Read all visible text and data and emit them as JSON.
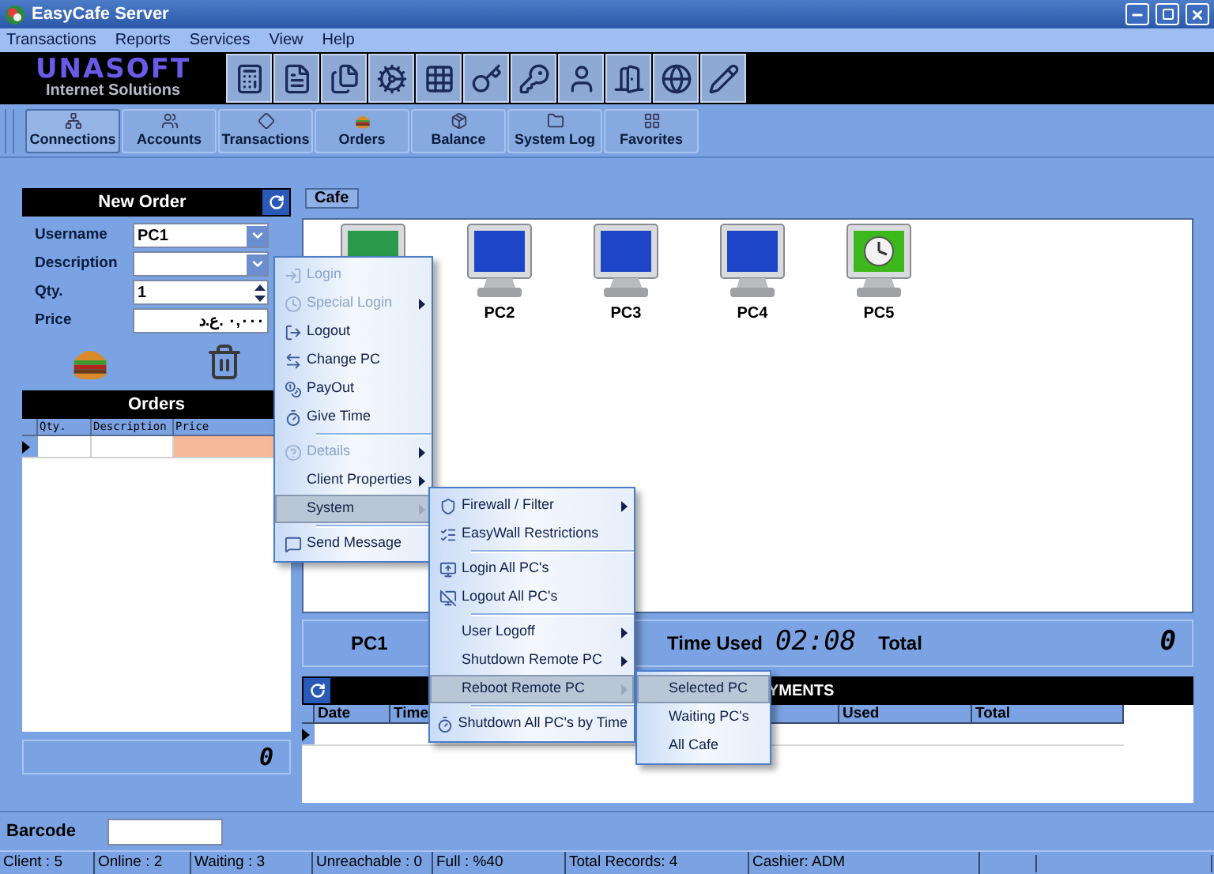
{
  "window": {
    "title": "EasyCafe Server"
  },
  "menu_bar": [
    "Transactions",
    "Reports",
    "Services",
    "View",
    "Help"
  ],
  "logo": {
    "title": "UNASOFT",
    "subtitle": "Internet Solutions"
  },
  "tabs": [
    {
      "label": "Connections",
      "selected": true
    },
    {
      "label": "Accounts",
      "selected": false
    },
    {
      "label": "Transactions",
      "selected": false
    },
    {
      "label": "Orders",
      "selected": false
    },
    {
      "label": "Balance",
      "selected": false
    },
    {
      "label": "System Log",
      "selected": false
    },
    {
      "label": "Favorites",
      "selected": false
    }
  ],
  "new_order": {
    "title": "New Order",
    "fields": [
      {
        "label": "Username",
        "value": "PC1",
        "kind": "dropdown"
      },
      {
        "label": "Description",
        "kind": "dropdown"
      },
      {
        "label": "Qty.",
        "value": "1",
        "kind": "spinner"
      },
      {
        "label": "Price",
        "value": "٠,٠٠٠ .ع.د",
        "kind": "text"
      }
    ]
  },
  "orders": {
    "title": "Orders",
    "columns": [
      "Qty.",
      "Description",
      "Price"
    ]
  },
  "order_total": "0",
  "cafe": {
    "tab": "Cafe",
    "pcs": [
      {
        "kind": "in_use"
      },
      {
        "name": "PC2",
        "kind": "idle"
      },
      {
        "name": "PC3",
        "kind": "idle"
      },
      {
        "name": "PC4",
        "kind": "idle"
      },
      {
        "name": "PC5",
        "kind": "timed"
      }
    ]
  },
  "session": {
    "pc": "PC1",
    "time_used_label": "Time Used",
    "time_used": "02:08",
    "total_label": "Total",
    "total": "0"
  },
  "payments": {
    "title": "YMENTS",
    "columns": [
      "Date",
      "Time",
      "Used",
      "Total"
    ]
  },
  "barcode": {
    "label": "Barcode"
  },
  "status_bar": [
    "Client : 5",
    "Online : 2",
    "Waiting : 3",
    "Unreachable : 0",
    "Full : %40",
    "Total Records: 4",
    "Cashier: ADM"
  ],
  "context_menu": [
    {
      "kind": "item",
      "label": "Login",
      "disabled": true,
      "has_submenu": false,
      "selected": false
    },
    {
      "kind": "item",
      "label": "Special Login",
      "disabled": true,
      "has_submenu": true,
      "selected": false
    },
    {
      "kind": "item",
      "label": "Logout",
      "disabled": false,
      "has_submenu": false,
      "selected": false
    },
    {
      "kind": "item",
      "label": "Change PC",
      "disabled": false,
      "has_submenu": false,
      "selected": false
    },
    {
      "kind": "item",
      "label": "PayOut",
      "disabled": false,
      "has_submenu": false,
      "selected": false
    },
    {
      "kind": "item",
      "label": "Give Time",
      "disabled": false,
      "has_submenu": false,
      "selected": false
    },
    {
      "kind": "separator"
    },
    {
      "kind": "item",
      "label": "Details",
      "disabled": true,
      "has_submenu": true,
      "selected": false
    },
    {
      "kind": "item",
      "label": "Client Properties",
      "disabled": false,
      "has_submenu": true,
      "selected": false
    },
    {
      "kind": "item",
      "label": "System",
      "disabled": false,
      "has_submenu": true,
      "selected": true,
      "children": [
        {
          "kind": "item",
          "label": "Firewall / Filter",
          "disabled": false,
          "has_submenu": true,
          "selected": false
        },
        {
          "kind": "item",
          "label": "EasyWall Restrictions",
          "disabled": false,
          "has_submenu": false,
          "selected": false
        },
        {
          "kind": "separator"
        },
        {
          "kind": "item",
          "label": "Login All PC's",
          "disabled": false,
          "has_submenu": false,
          "selected": false
        },
        {
          "kind": "item",
          "label": "Logout All PC's",
          "disabled": false,
          "has_submenu": false,
          "selected": false
        },
        {
          "kind": "separator"
        },
        {
          "kind": "item",
          "label": "User Logoff",
          "disabled": false,
          "has_submenu": true,
          "selected": false
        },
        {
          "kind": "item",
          "label": "Shutdown Remote PC",
          "disabled": false,
          "has_submenu": true,
          "selected": false
        },
        {
          "kind": "item",
          "label": "Reboot Remote PC",
          "disabled": false,
          "has_submenu": true,
          "selected": true,
          "children": [
            {
              "kind": "item",
              "label": "Selected PC",
              "disabled": false,
              "has_submenu": false,
              "selected": true
            },
            {
              "kind": "item",
              "label": "Waiting PC's",
              "disabled": false,
              "has_submenu": false,
              "selected": false
            },
            {
              "kind": "item",
              "label": "All Cafe",
              "disabled": false,
              "has_submenu": false,
              "selected": false
            }
          ]
        },
        {
          "kind": "separator"
        },
        {
          "kind": "item",
          "label": "Shutdown All PC's by Time",
          "disabled": false,
          "has_submenu": false,
          "selected": false
        }
      ]
    },
    {
      "kind": "separator"
    },
    {
      "kind": "item",
      "label": "Send Message",
      "disabled": false,
      "has_submenu": false,
      "selected": false
    }
  ]
}
